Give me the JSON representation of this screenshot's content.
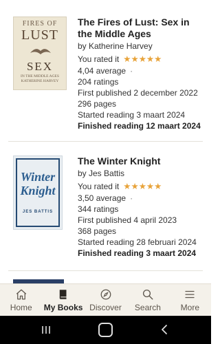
{
  "books": [
    {
      "title": "The Fires of Lust: Sex in the Middle Ages",
      "author_line": "by Katherine Harvey",
      "rated_label": "You rated it",
      "stars": "★★★★★",
      "rating_stars": 5,
      "average": "4,04 average",
      "ratings": "204 ratings",
      "first_published": "First published 2 december 2022",
      "pages": "296 pages",
      "started": "Started reading 3 maart 2024",
      "finished": "Finished reading 12 maart 2024",
      "cover": {
        "top_text": "FIRES OF",
        "big_text": "LUST",
        "sex_text": "SEX",
        "sub_text": "IN THE MIDDLE AGES",
        "author_text": "KATHERINE HARVEY"
      }
    },
    {
      "title": "The Winter Knight",
      "author_line": "by Jes Battis",
      "rated_label": "You rated it",
      "stars": "★★★★★",
      "rating_stars": 5,
      "average": "3,50 average",
      "ratings": "344 ratings",
      "first_published": "First published 4 april 2023",
      "pages": "368 pages",
      "started": "Started reading 28 februari 2024",
      "finished": "Finished reading 3 maart 2024",
      "cover": {
        "title_line1": "Winter",
        "title_line2": "Knight",
        "author_text": "JES BATTIS"
      }
    }
  ],
  "average_separator": "·",
  "tabs": [
    {
      "label": "Home",
      "icon": "home-icon",
      "active": false
    },
    {
      "label": "My Books",
      "icon": "book-icon",
      "active": true
    },
    {
      "label": "Discover",
      "icon": "compass-icon",
      "active": false
    },
    {
      "label": "Search",
      "icon": "search-icon",
      "active": false
    },
    {
      "label": "More",
      "icon": "menu-icon",
      "active": false
    }
  ],
  "colors": {
    "star": "#e8a33a",
    "tabbar_bg": "#f4f1ea",
    "text": "#222222"
  }
}
